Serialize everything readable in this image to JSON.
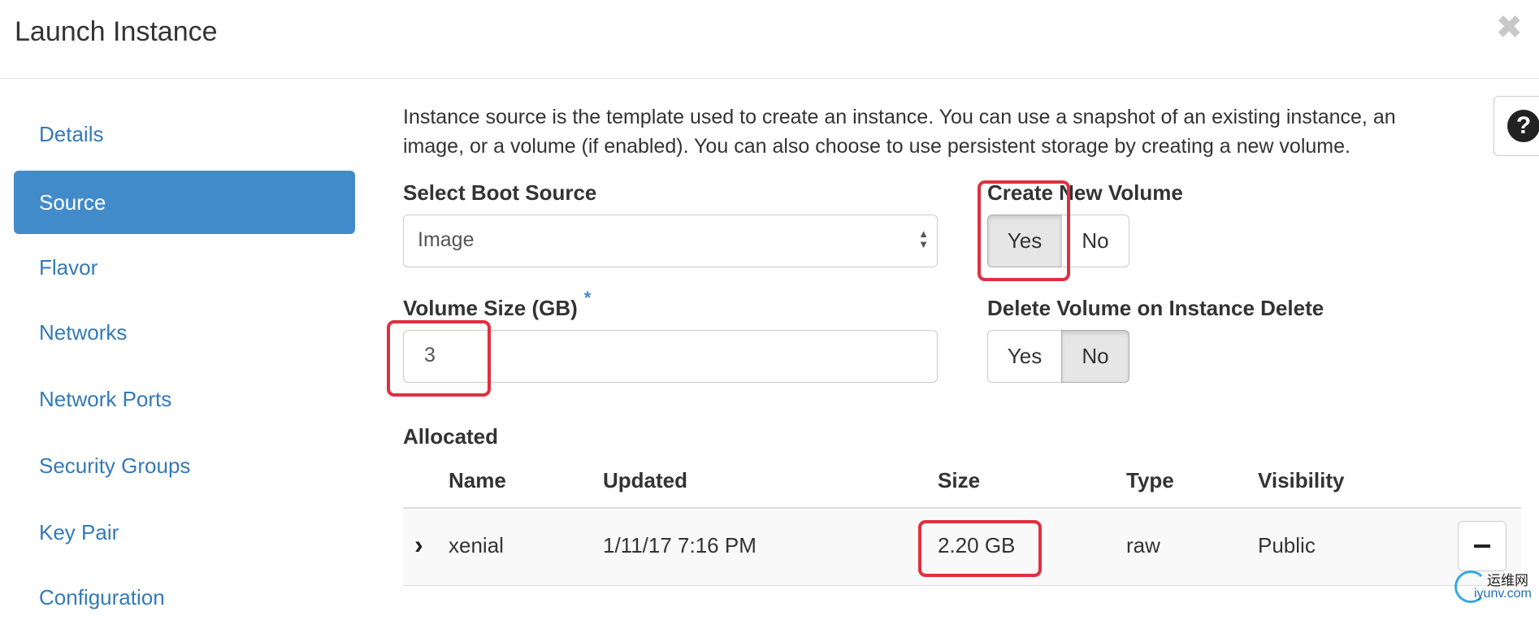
{
  "header": {
    "title": "Launch Instance",
    "close_symbol": "✖"
  },
  "sidebar": {
    "items": [
      {
        "label": "Details"
      },
      {
        "label": "Source"
      },
      {
        "label": "Flavor"
      },
      {
        "label": "Networks"
      },
      {
        "label": "Network Ports"
      },
      {
        "label": "Security Groups"
      },
      {
        "label": "Key Pair"
      },
      {
        "label": "Configuration"
      }
    ],
    "active": "Source"
  },
  "help": {
    "symbol": "?"
  },
  "main": {
    "description": "Instance source is the template used to create an instance. You can use a snapshot of an existing instance, an image, or a volume (if enabled). You can also choose to use persistent storage by creating a new volume.",
    "boot_source": {
      "label": "Select Boot Source",
      "value": "Image"
    },
    "create_volume": {
      "label": "Create New Volume",
      "yes": "Yes",
      "no": "No",
      "selected": "Yes"
    },
    "volume_size": {
      "label": "Volume Size (GB)",
      "required_mark": "*",
      "value": "3"
    },
    "delete_volume": {
      "label": "Delete Volume on Instance Delete",
      "yes": "Yes",
      "no": "No",
      "selected": "No"
    },
    "allocated": {
      "label": "Allocated",
      "columns": [
        "Name",
        "Updated",
        "Size",
        "Type",
        "Visibility"
      ],
      "rows": [
        {
          "name": "xenial",
          "updated": "1/11/17 7:16 PM",
          "size": "2.20 GB",
          "type": "raw",
          "visibility": "Public"
        }
      ]
    }
  },
  "watermark": {
    "cn": "运维网",
    "en": "iyunv.com"
  },
  "colors": {
    "primary": "#428bca",
    "link": "#337ab7",
    "highlight": "#e0303f",
    "help_icon": "#222222"
  }
}
